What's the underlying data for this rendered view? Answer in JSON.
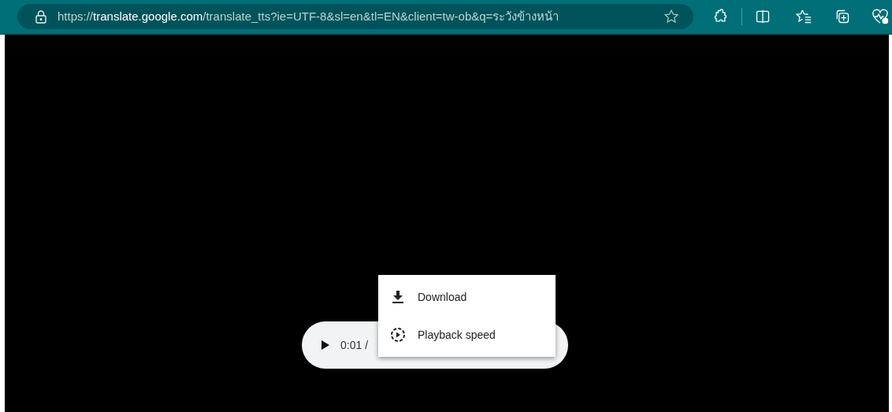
{
  "address_bar": {
    "scheme": "https://",
    "host": "translate.google.com",
    "path": "/translate_tts?ie=UTF-8&sl=en&tl=EN&client=tw-ob&q=ระวังข้างหน้า"
  },
  "player": {
    "time": "0:01 /"
  },
  "menu": [
    {
      "kind": "download",
      "label": "Download"
    },
    {
      "kind": "speed",
      "label": "Playback speed"
    }
  ]
}
